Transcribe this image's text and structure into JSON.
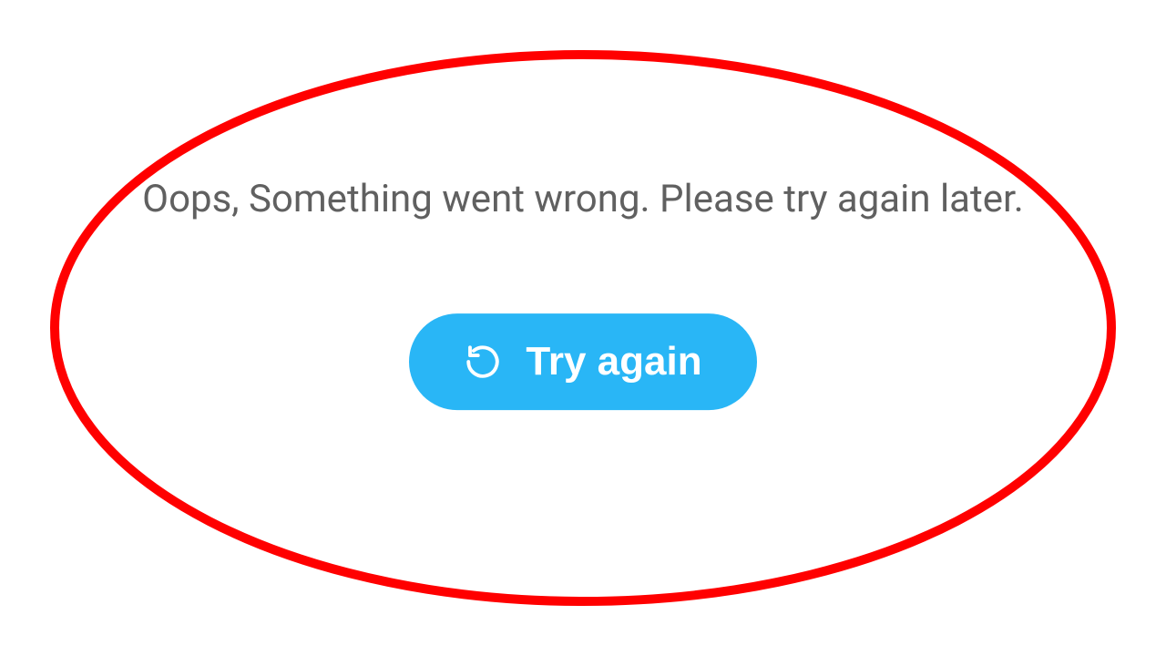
{
  "error": {
    "message": "Oops, Something went wrong. Please try again later."
  },
  "retry": {
    "label": "Try again",
    "icon_name": "refresh-ccw-icon"
  },
  "annotation": {
    "stroke": "#ff0000"
  },
  "accent": "#29b6f6"
}
